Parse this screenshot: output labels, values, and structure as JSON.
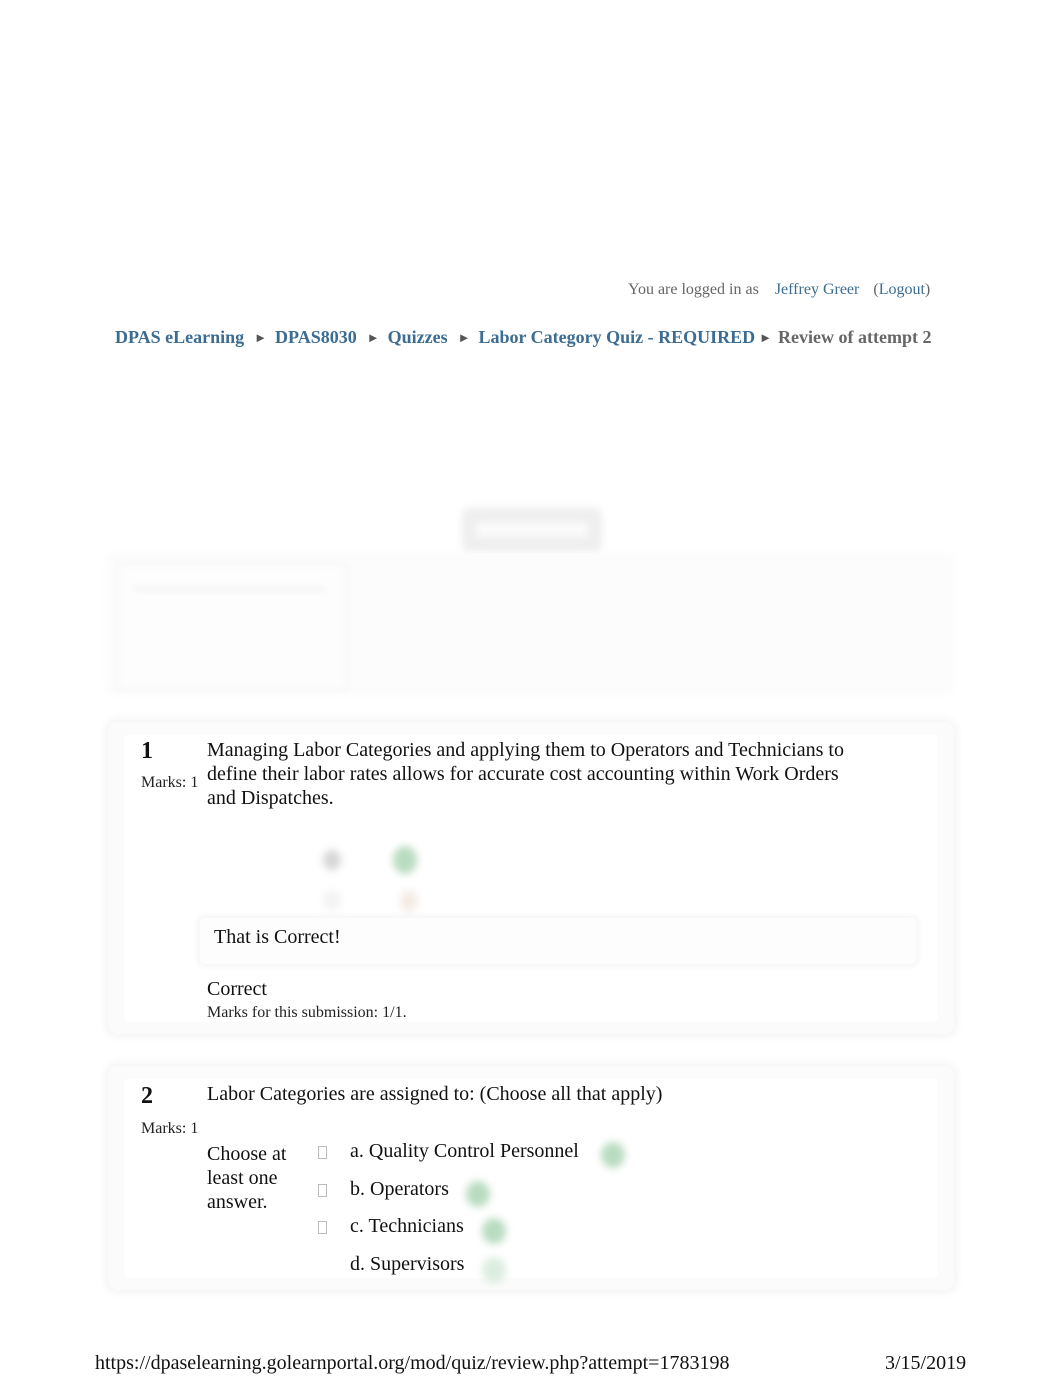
{
  "login": {
    "prefix": "You are logged in as",
    "user_name": "Jeffrey Greer",
    "open_paren": "(",
    "logout_label": "Logout",
    "close_paren": ")"
  },
  "breadcrumb": {
    "separator": "►",
    "items": [
      {
        "label": "DPAS eLearning",
        "link": true
      },
      {
        "label": "DPAS8030",
        "link": true
      },
      {
        "label": "Quizzes",
        "link": true
      },
      {
        "label": "Labor Category Quiz - REQUIRED",
        "link": true
      },
      {
        "label": "Review of attempt 2",
        "link": false
      }
    ]
  },
  "colors": {
    "link": "#3c6c91",
    "muted_text": "#666666",
    "correct_tick": "#b9dcc0"
  },
  "questions": [
    {
      "number": "1",
      "marks_label": "Marks: 1",
      "text": "Managing Labor Categories and applying them to Operators and Technicians to define their labor rates allows for accurate cost accounting within Work Orders and Dispatches.",
      "answer_icons": [
        "radio-icon",
        "correct-tick-icon",
        "radio-icon",
        "incorrect-cross-icon"
      ],
      "feedback": "That is Correct!",
      "grade": "Correct",
      "marks_for_submission": "Marks for this submission: 1/1."
    },
    {
      "number": "2",
      "marks_label": "Marks: 1",
      "text": "Labor Categories are assigned to: (Choose all that apply)",
      "prompt": "Choose at least one answer.",
      "answers": [
        {
          "label": "a. Quality Control Personnel",
          "checked": true,
          "icon": "correct-tick-icon"
        },
        {
          "label": "b. Operators",
          "checked": true,
          "icon": "correct-tick-icon"
        },
        {
          "label": "c. Technicians",
          "checked": true,
          "icon": "correct-tick-icon"
        },
        {
          "label": "d. Supervisors",
          "checked": false,
          "icon": "correct-tick-icon"
        }
      ]
    }
  ],
  "footer": {
    "url": "https://dpaselearning.golearnportal.org/mod/quiz/review.php?attempt=1783198",
    "date": "3/15/2019"
  }
}
